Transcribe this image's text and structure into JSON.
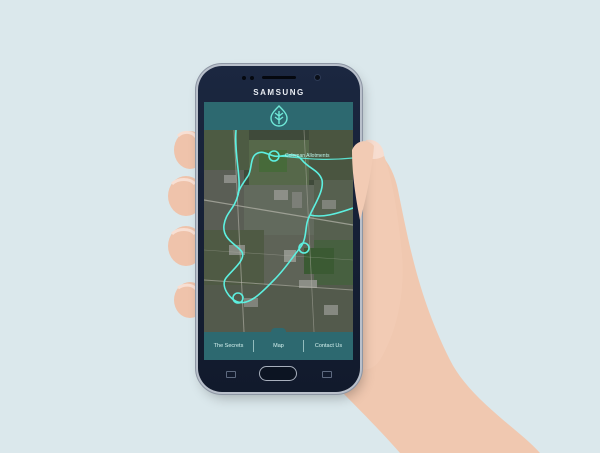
{
  "phone": {
    "brand": "SAMSUNG"
  },
  "app": {
    "logo_icon": "leaf-drop-logo-icon",
    "map": {
      "place_label": "Coleman Allotments"
    },
    "nav": [
      {
        "label": "The Secrets"
      },
      {
        "label": "Map"
      },
      {
        "label": "Contact Us"
      }
    ]
  },
  "colors": {
    "background": "#dbe8ec",
    "app_teal": "#2d6970",
    "route_cyan": "#5df0e0",
    "phone_body": "#1b2740"
  }
}
